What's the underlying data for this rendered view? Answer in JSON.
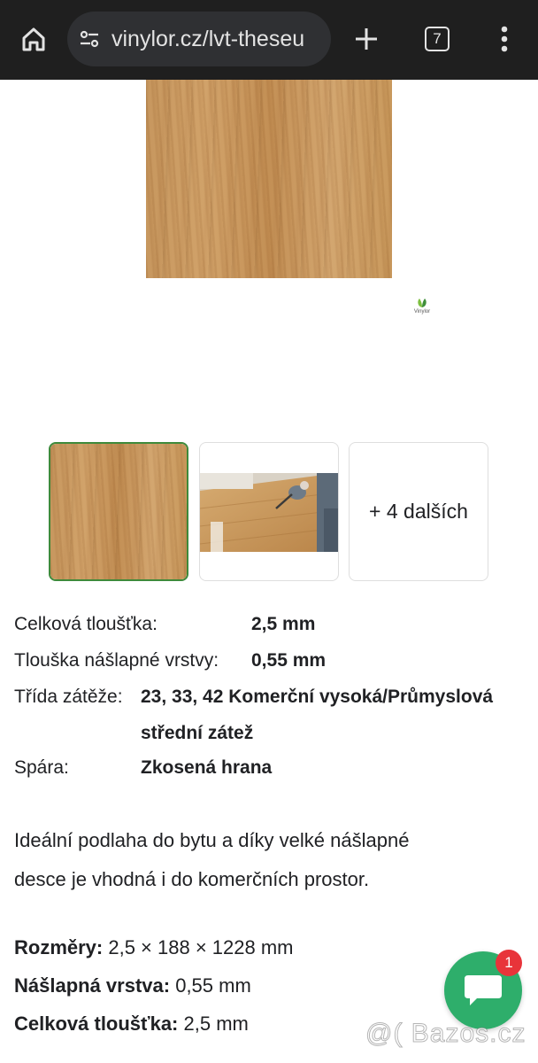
{
  "browser": {
    "url": "vinylor.cz/lvt-theseu",
    "tab_count": "7"
  },
  "logo_text": "Vinylor",
  "gallery": {
    "more_label": "+ 4 dalších"
  },
  "specs": [
    {
      "label": "Celková tloušťka:",
      "value": "2,5 mm"
    },
    {
      "label": "Tlouška nášlapné vrstvy:",
      "value": "0,55 mm"
    },
    {
      "label": "Třída zátěže:",
      "value_line1": "23, 33, 42 Komerční vysoká/Průmyslová",
      "value_line2": "střední zátež"
    },
    {
      "label": "Spára:",
      "value": "Zkosená hrana"
    }
  ],
  "description": {
    "line1": "Ideální podlaha do bytu a díky velké nášlapné",
    "line2": "desce je vhodná i do komerčních prostor."
  },
  "dimensions": [
    {
      "label": "Rozměry:",
      "value": " 2,5 × 188 × 1228 mm"
    },
    {
      "label": "Nášlapná vrstva:",
      "value": " 0,55 mm"
    },
    {
      "label": "Celková tloušťka:",
      "value": " 2,5 mm"
    }
  ],
  "chat": {
    "badge_count": "1"
  },
  "watermark": "@( Bazos.cz",
  "colors": {
    "browser_bar": "#1f1f1f",
    "accent_green": "#2eae6b",
    "selected_thumb_border": "#3e8a3b",
    "badge_red": "#e8343a"
  }
}
